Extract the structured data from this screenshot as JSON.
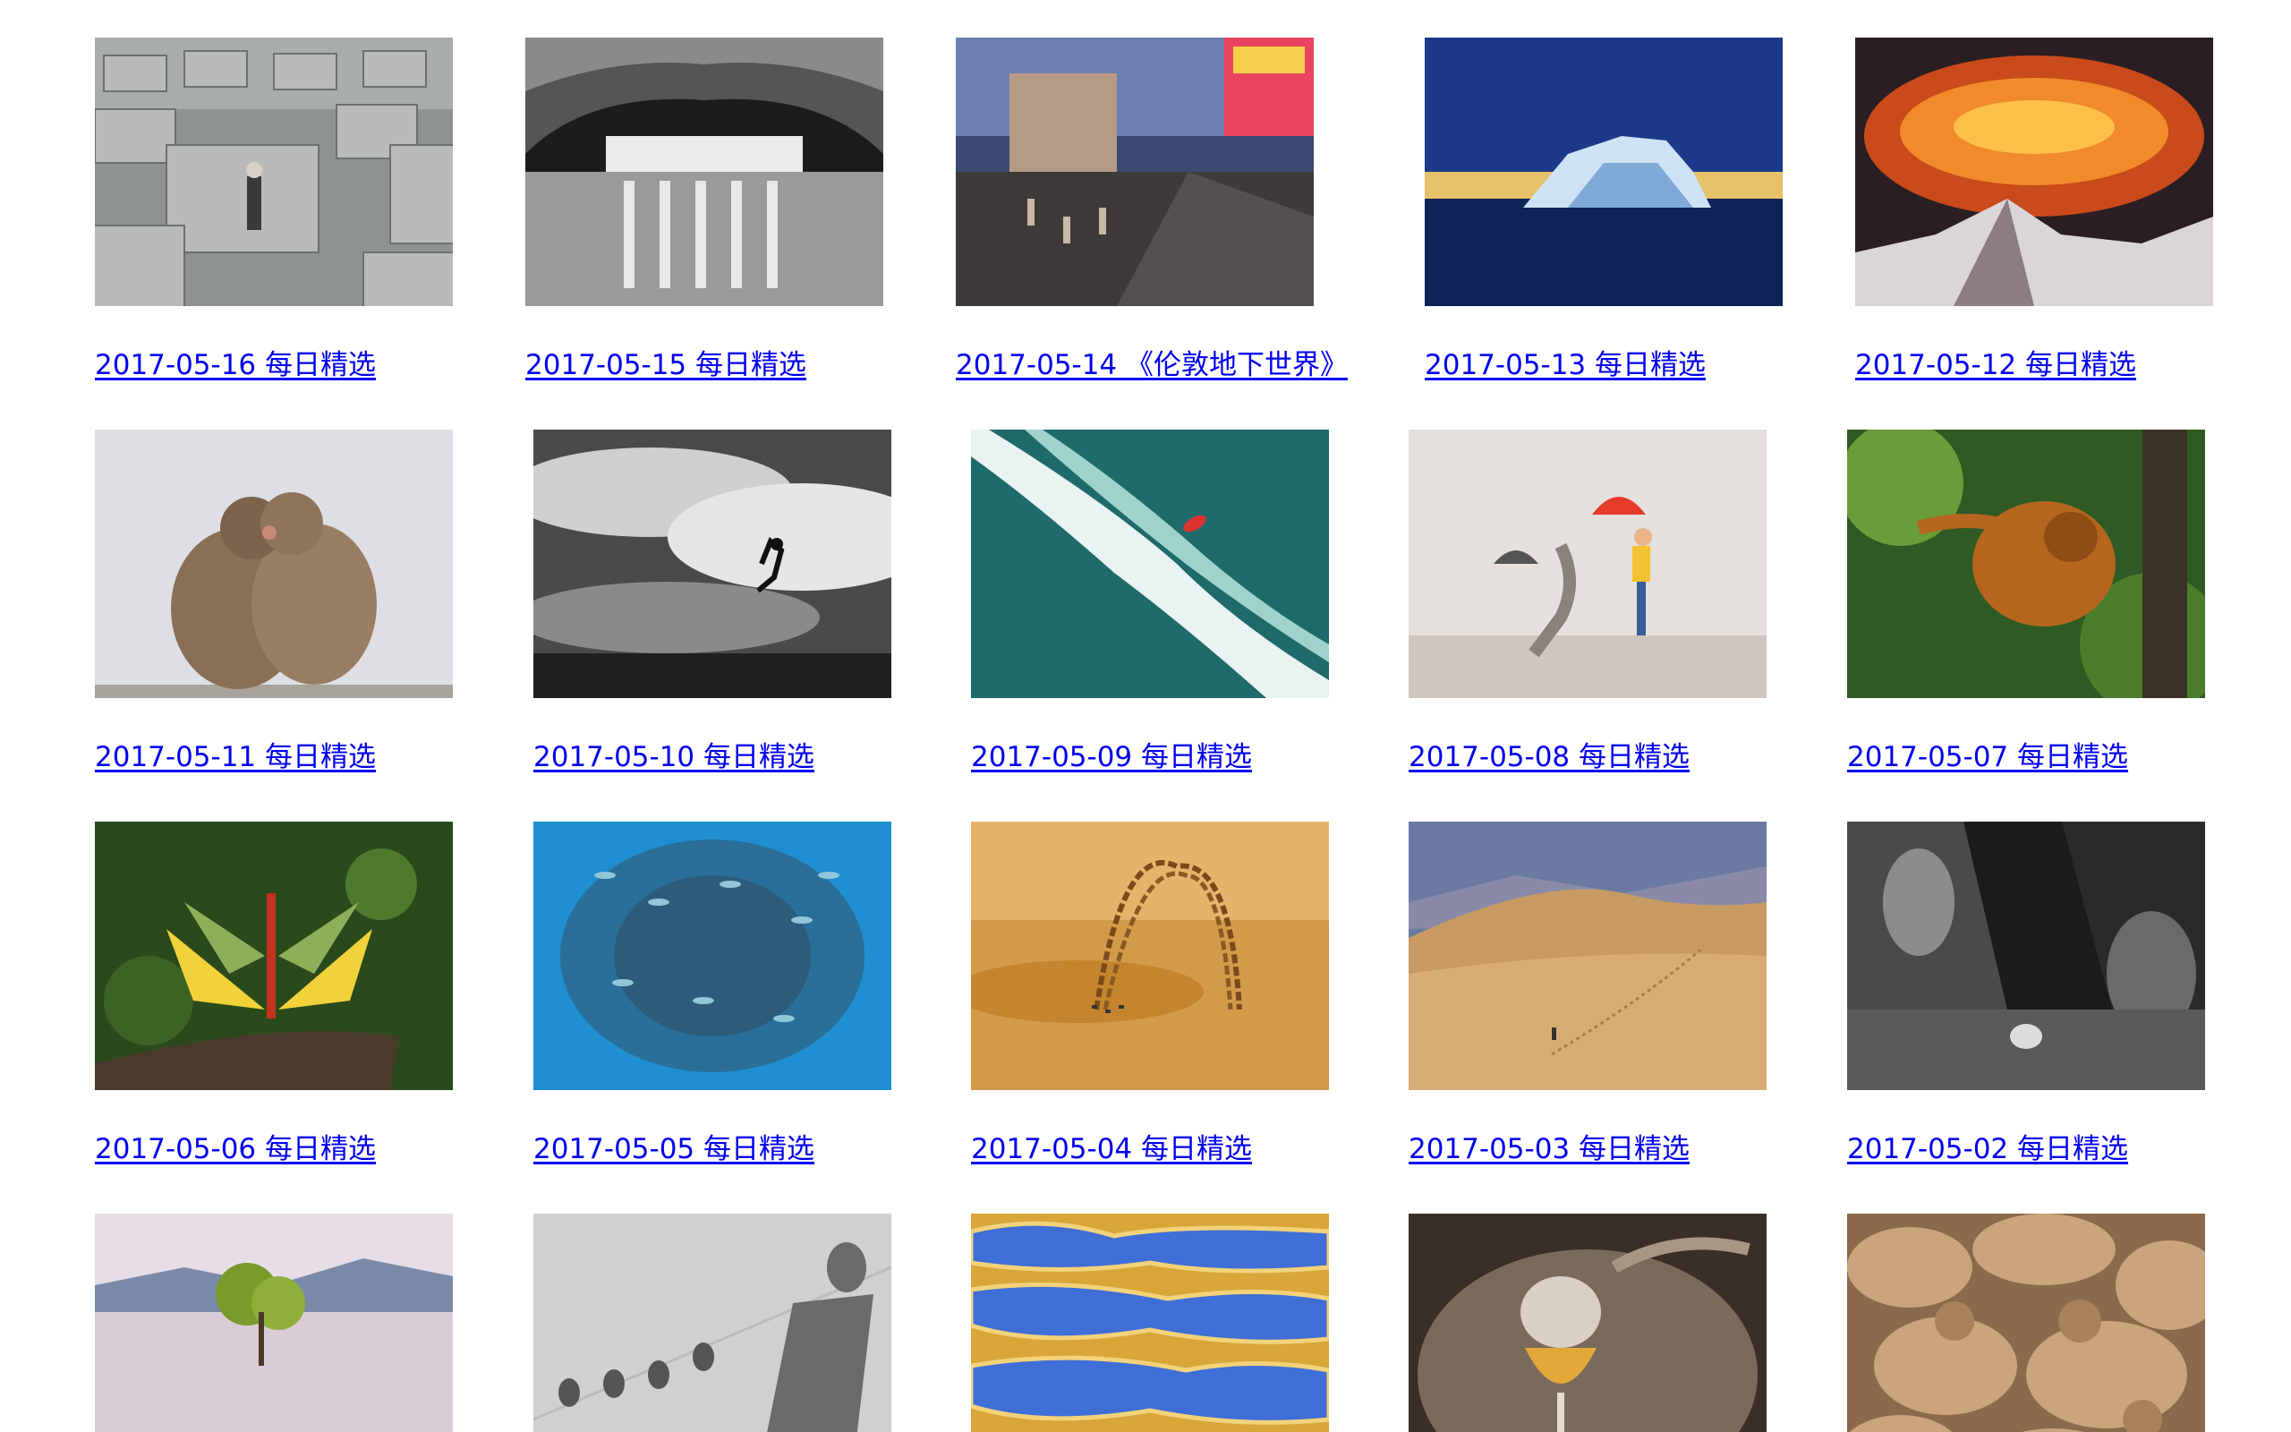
{
  "gallery": {
    "items": [
      {
        "caption": "2017-05-16 每日精选",
        "image": "holocaust-memorial-concrete-blocks-photo"
      },
      {
        "caption": "2017-05-15 每日精选",
        "image": "cave-subway-station-bw-photo"
      },
      {
        "caption": "2017-05-14 《伦敦地下世界》",
        "image": "piccadilly-circus-underground-entrance-photo"
      },
      {
        "caption": "2017-05-13 每日精选",
        "image": "blue-iceberg-at-dusk-photo"
      },
      {
        "caption": "2017-05-12 每日精选",
        "image": "fiery-cloud-over-snowy-peak-photo"
      },
      {
        "caption": "2017-05-11 每日精选",
        "image": "snow-monkeys-hugging-photo"
      },
      {
        "caption": "2017-05-10 每日精选",
        "image": "man-leaping-under-dramatic-sky-bw-photo"
      },
      {
        "caption": "2017-05-09 每日精选",
        "image": "aerial-wave-with-surfer-photo"
      },
      {
        "caption": "2017-05-08 每日精选",
        "image": "girl-with-umbrellas-shadow-photo"
      },
      {
        "caption": "2017-05-07 每日精选",
        "image": "orangutan-in-tree-photo"
      },
      {
        "caption": "2017-05-06 每日精选",
        "image": "lanternflies-on-branch-photo"
      },
      {
        "caption": "2017-05-05 每日精选",
        "image": "school-of-fish-underwater-photo"
      },
      {
        "caption": "2017-05-04 每日精选",
        "image": "aerobatic-jets-smoke-trails-photo"
      },
      {
        "caption": "2017-05-03 每日精选",
        "image": "desert-dunes-lone-figure-photo"
      },
      {
        "caption": "2017-05-02 每日精选",
        "image": "children-at-aquarium-glass-bw-photo"
      },
      {
        "caption": "",
        "image": "lone-tree-in-lake-photo"
      },
      {
        "caption": "",
        "image": "shadows-on-wall-bw-photo"
      },
      {
        "caption": "",
        "image": "rice-terraces-blue-water-photo"
      },
      {
        "caption": "",
        "image": "pouring-wine-in-cellar-photo"
      },
      {
        "caption": "",
        "image": "sea-lions-group-photo"
      }
    ]
  }
}
